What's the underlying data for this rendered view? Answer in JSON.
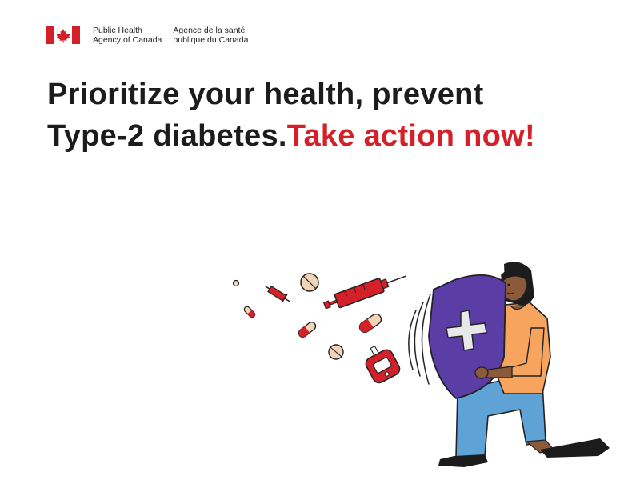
{
  "header": {
    "agency_en_line1": "Public Health",
    "agency_en_line2": "Agency of Canada",
    "agency_fr_line1": "Agence de la santé",
    "agency_fr_line2": "publique du Canada"
  },
  "headline": {
    "line1": "Prioritize your health, prevent",
    "line2_start": "Type-2 diabetes.",
    "line2_accent": "Take action now!"
  },
  "colors": {
    "accent_red": "#d42028",
    "shield_purple": "#5a3ea6",
    "shirt_orange": "#f6a45e",
    "pants_blue": "#5fa3d6",
    "text_dark": "#1c1c1c"
  },
  "icons": [
    "canada-flag-icon",
    "syringe-icon",
    "pill-icon",
    "tablet-icon",
    "glucose-meter-icon",
    "shield-icon"
  ]
}
